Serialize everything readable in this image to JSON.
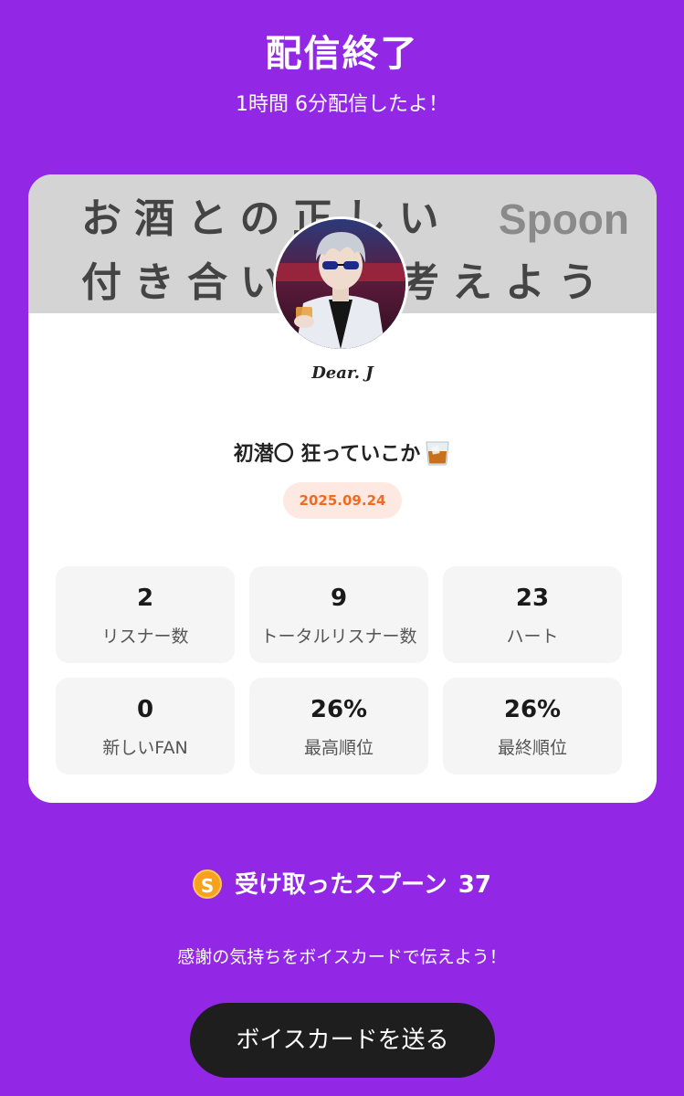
{
  "header": {
    "title": "配信終了",
    "subtitle": "1時間 6分配信したよ！"
  },
  "card": {
    "banner": {
      "line1": "お酒との正しい",
      "line2": "付き合い方を考えよう",
      "logo_text": "Spoon",
      "background": "#d4d4d4"
    },
    "host_name": "Dear. J",
    "live_title": "初潜〇 狂っていこか",
    "live_title_icon": "whiskey-glass-icon",
    "date": "2025.09.24",
    "stats": [
      {
        "value": "2",
        "label": "リスナー数"
      },
      {
        "value": "9",
        "label": "トータルリスナー数"
      },
      {
        "value": "23",
        "label": "ハート"
      },
      {
        "value": "0",
        "label": "新しいFAN"
      },
      {
        "value": "26%",
        "label": "最高順位"
      },
      {
        "value": "26%",
        "label": "最終順位"
      }
    ]
  },
  "spoons": {
    "icon": "spoon-coin-icon",
    "label": "受け取ったスプーン",
    "count": "37"
  },
  "thanks_text": "感謝の気持ちをボイスカードで伝えよう！",
  "send_button_label": "ボイスカードを送る",
  "colors": {
    "background": "#9227e6",
    "date_text": "#f26a21",
    "date_pill": "#fde9e1",
    "button": "#1e1e1e",
    "coin": "#f7a21d"
  }
}
